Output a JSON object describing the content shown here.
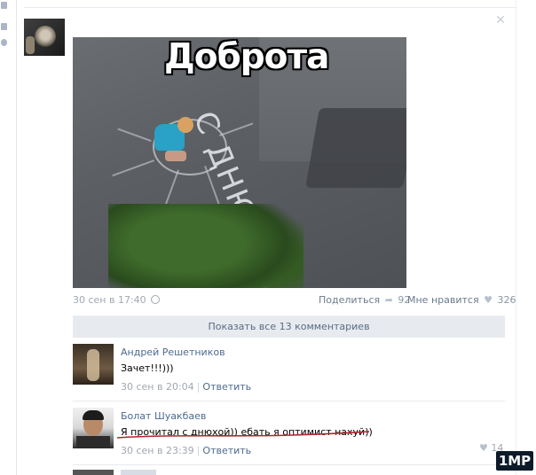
{
  "post": {
    "image_caption": "Доброта",
    "chalk_text": "С ДНЮХОЙ",
    "date": "30 сен в 17:40",
    "share_label": "Поделиться",
    "share_count": "92",
    "like_label": "Мне нравится",
    "like_count": "326"
  },
  "comments_bar": {
    "show_all": "Показать все 13 комментариев"
  },
  "comments": [
    {
      "author": "Андрей Решетников",
      "text": "Зачет!!!)))",
      "date": "30 сен в 20:04",
      "reply": "Ответить"
    },
    {
      "author": "Болат Шуакбаев",
      "text": "Я прочитал с днюхой)) ебать я оптимист нахуй))",
      "date": "30 сен в 23:39",
      "reply": "Ответить",
      "likes": "14"
    }
  ],
  "watermark": "1MP",
  "colors": {
    "link": "#4e6a8e",
    "meta": "#a0a8b2",
    "bar_bg": "#e7ebf0",
    "underline": "#b3262e"
  }
}
